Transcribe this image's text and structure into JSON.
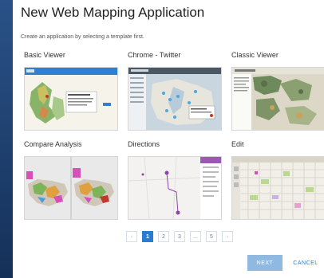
{
  "dialog": {
    "title": "New Web Mapping Application",
    "subtitle": "Create an application by selecting a template first."
  },
  "templates": [
    {
      "label": "Basic Viewer",
      "thumb_icon": "basic-viewer-thumbnail"
    },
    {
      "label": "Chrome - Twitter",
      "thumb_icon": "chrome-twitter-thumbnail"
    },
    {
      "label": "Classic Viewer",
      "thumb_icon": "classic-viewer-thumbnail"
    },
    {
      "label": "Compare Analysis",
      "thumb_icon": "compare-analysis-thumbnail"
    },
    {
      "label": "Directions",
      "thumb_icon": "directions-thumbnail"
    },
    {
      "label": "Edit",
      "thumb_icon": "edit-thumbnail"
    }
  ],
  "pagination": {
    "prev": "‹",
    "pages": [
      "1",
      "2",
      "3",
      "...",
      "5"
    ],
    "next": "›",
    "current": "1"
  },
  "footer": {
    "next_label": "NEXT",
    "cancel_label": "CANCEL"
  },
  "colors": {
    "accent": "#2b7bd0",
    "backdrop": "#1f3f6e"
  }
}
